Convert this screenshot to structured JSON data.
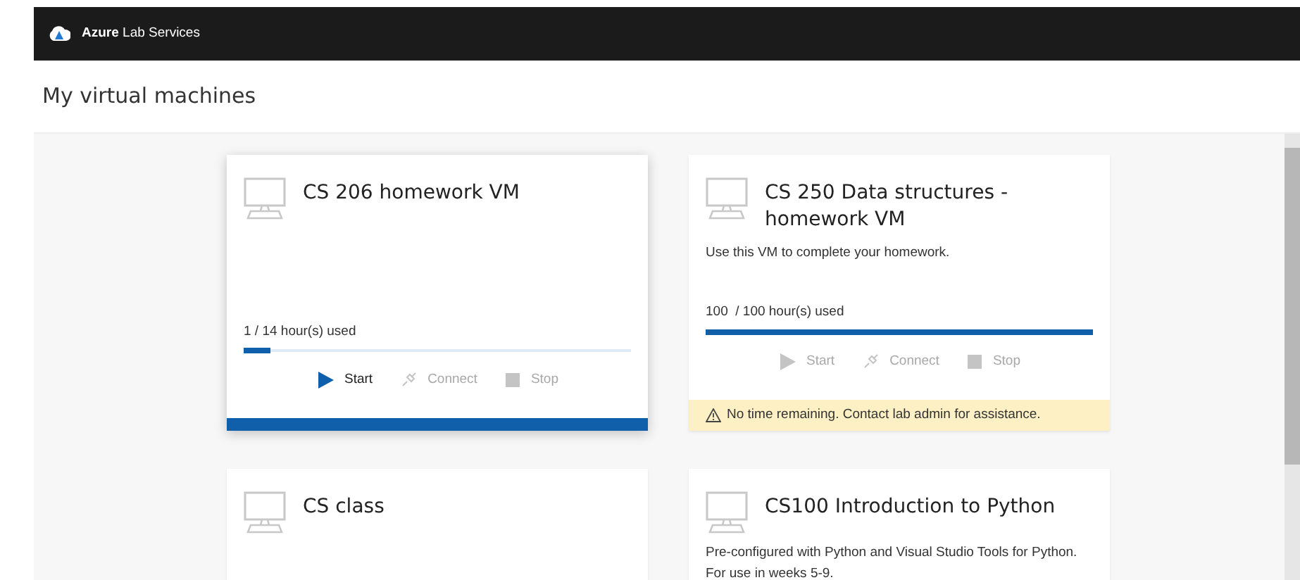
{
  "header": {
    "brand_bold": "Azure",
    "brand_rest": "Lab Services"
  },
  "page_title": "My virtual machines",
  "vms": [
    {
      "name": "CS 206 homework VM",
      "selected": true,
      "usage": "1 / 14 hour(s) used",
      "level": 0.07,
      "actions": [
        {
          "kind": "start",
          "label": "Start",
          "disabled": false
        },
        {
          "kind": "connect",
          "label": "Connect",
          "disabled": true
        },
        {
          "kind": "stop",
          "label": "Stop",
          "disabled": true
        }
      ]
    },
    {
      "name": "CS 250 Data structures - homework VM",
      "selected": false,
      "description": "Use this VM to complete your homework.",
      "usage": "100  / 100 hour(s) used",
      "level": 1,
      "actions": [
        {
          "kind": "start",
          "label": "Start",
          "disabled": true
        },
        {
          "kind": "connect",
          "label": "Connect",
          "disabled": true
        },
        {
          "kind": "stop",
          "label": "Stop",
          "disabled": true
        }
      ],
      "warning": "No time remaining. Contact lab admin for assistance."
    },
    {
      "name": "CS class",
      "selected": false
    },
    {
      "name": "CS100 Introduction to Python",
      "selected": false,
      "description": "Pre-configured with Python and Visual Studio Tools for Python. For use in weeks 5-9."
    }
  ]
}
